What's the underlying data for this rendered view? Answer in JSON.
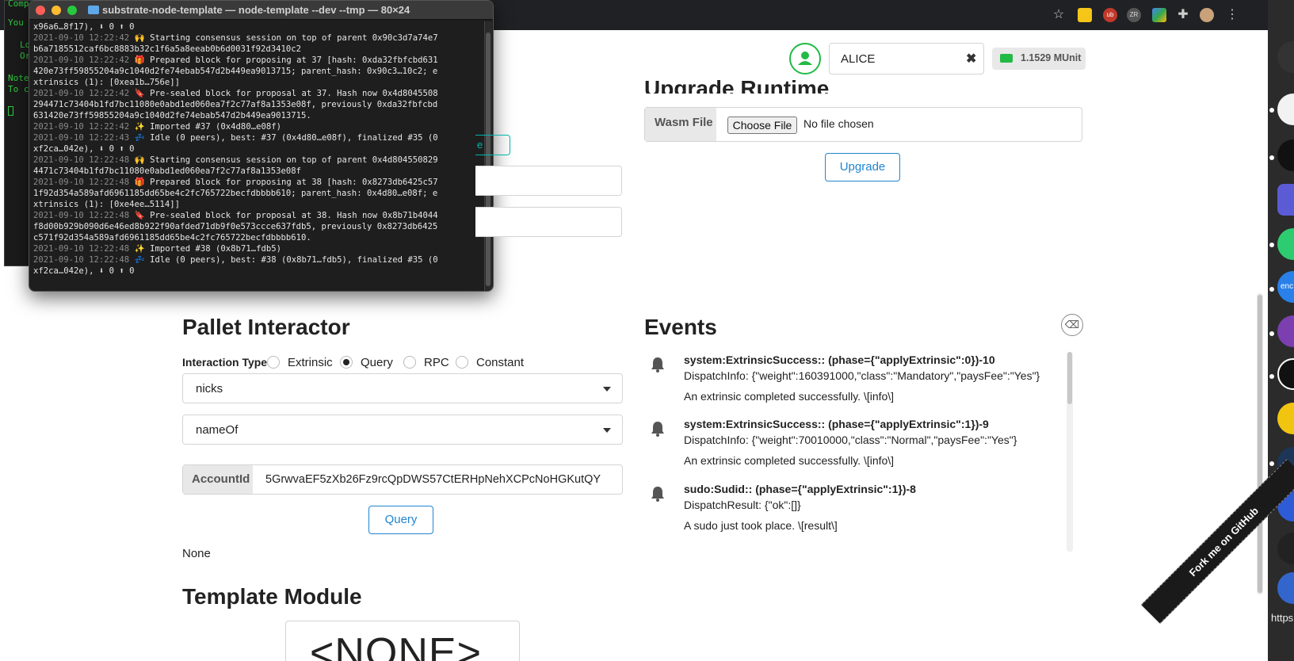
{
  "terminal": {
    "title": "substrate-node-template — node-template --dev --tmp — 80×24",
    "background_fragments": [
      "Comp",
      "You c",
      "Lo",
      "Or",
      "Note",
      "To c"
    ],
    "lines": [
      {
        "ts": "",
        "text": "x96a6…8f17), ⬇ 0 ⬆ 0"
      },
      {
        "ts": "2021-09-10 12:22:42",
        "text": " 🙌 Starting consensus session on top of parent 0x90c3d7a74e7"
      },
      {
        "ts": "",
        "text": "b6a7185512caf6bc8883b32c1f6a5a8eeab0b6d0031f92d3410c2"
      },
      {
        "ts": "2021-09-10 12:22:42",
        "text": " 🎁 Prepared block for proposing at 37 [hash: 0xda32fbfcbd631"
      },
      {
        "ts": "",
        "text": "420e73ff59855204a9c1040d2fe74ebab547d2b449ea9013715; parent_hash: 0x90c3…10c2; e"
      },
      {
        "ts": "",
        "text": "xtrinsics (1): [0xea1b…756e]]"
      },
      {
        "ts": "2021-09-10 12:22:42",
        "text": " 🔖 Pre-sealed block for proposal at 37. Hash now 0x4d8045508"
      },
      {
        "ts": "",
        "text": "294471c73404b1fd7bc11080e0abd1ed060ea7f2c77af8a1353e08f, previously 0xda32fbfcbd"
      },
      {
        "ts": "",
        "text": "631420e73ff59855204a9c1040d2fe74ebab547d2b449ea9013715."
      },
      {
        "ts": "2021-09-10 12:22:42",
        "text": " ✨ Imported #37 (0x4d80…e08f)"
      },
      {
        "ts": "2021-09-10 12:22:43",
        "text": " 💤 Idle (0 peers), best: #37 (0x4d80…e08f), finalized #35 (0"
      },
      {
        "ts": "",
        "text": "xf2ca…042e), ⬇ 0 ⬆ 0"
      },
      {
        "ts": "2021-09-10 12:22:48",
        "text": " 🙌 Starting consensus session on top of parent 0x4d804550829"
      },
      {
        "ts": "",
        "text": "4471c73404b1fd7bc11080e0abd1ed060ea7f2c77af8a1353e08f"
      },
      {
        "ts": "2021-09-10 12:22:48",
        "text": " 🎁 Prepared block for proposing at 38 [hash: 0x8273db6425c57"
      },
      {
        "ts": "",
        "text": "1f92d354a589afd6961185dd65be4c2fc765722becfdbbbb610; parent_hash: 0x4d80…e08f; e"
      },
      {
        "ts": "",
        "text": "xtrinsics (1): [0xe4ee…5114]]"
      },
      {
        "ts": "2021-09-10 12:22:48",
        "text": " 🔖 Pre-sealed block for proposal at 38. Hash now 0x8b71b4044"
      },
      {
        "ts": "",
        "text": "f8d00b929b090d6e46ed8b922f90afded71db9f0e573ccce637fdb5, previously 0x8273db6425"
      },
      {
        "ts": "",
        "text": "c571f92d354a589afd6961185dd65be4c2fc765722becfdbbbb610."
      },
      {
        "ts": "2021-09-10 12:22:48",
        "text": " ✨ Imported #38 (0x8b71…fdb5)"
      },
      {
        "ts": "2021-09-10 12:22:48",
        "text": " 💤 Idle (0 peers), best: #38 (0x8b71…fdb5), finalized #35 (0"
      },
      {
        "ts": "",
        "text": "xf2ca…042e), ⬇ 0 ⬆ 0"
      }
    ]
  },
  "header": {
    "account": "ALICE",
    "clear_symbol": "✖",
    "balance": "1.1529 MUnit"
  },
  "upgrade": {
    "title": "Upgrade Runtime",
    "wasm_label": "Wasm File",
    "choose_label": "Choose File",
    "no_file": "No file chosen",
    "button": "Upgrade"
  },
  "ghost": {
    "button_fragment": "e"
  },
  "pallet": {
    "title": "Pallet Interactor",
    "interaction_label": "Interaction Type",
    "types": [
      "Extrinsic",
      "Query",
      "RPC",
      "Constant"
    ],
    "selected_type": "Query",
    "pallet_value": "nicks",
    "callable_value": "nameOf",
    "account_label": "AccountId",
    "account_value": "5GrwvaEF5zXb26Fz9rcQpDWS57CtERHpNehXCPcNoHGKutQY",
    "query_button": "Query",
    "result": "None"
  },
  "template": {
    "title": "Template Module",
    "value": "<NONE>"
  },
  "events": {
    "title": "Events",
    "items": [
      {
        "head": "system:ExtrinsicSuccess:: (phase={\"applyExtrinsic\":0})-10",
        "info": "DispatchInfo: {\"weight\":160391000,\"class\":\"Mandatory\",\"paysFee\":\"Yes\"}",
        "desc": "An extrinsic completed successfully. \\[info\\]"
      },
      {
        "head": "system:ExtrinsicSuccess:: (phase={\"applyExtrinsic\":1})-9",
        "info": "DispatchInfo: {\"weight\":70010000,\"class\":\"Normal\",\"paysFee\":\"Yes\"}",
        "desc": "An extrinsic completed successfully. \\[info\\]"
      },
      {
        "head": "sudo:Sudid:: (phase={\"applyExtrinsic\":1})-8",
        "info": "DispatchResult: {\"ok\":[]}",
        "desc": "A sudo just took place. \\[result\\]"
      }
    ]
  },
  "ribbon": "Fork me on GitHub",
  "browser": {
    "side_partial": [
      "enc",
      "https"
    ],
    "ext_labels": [
      "ub",
      "ZR"
    ]
  },
  "colors": {
    "accent_blue": "#2185d0",
    "green": "#21ba45",
    "teal": "#00b5ad",
    "terminal_bg": "#1e1e1e"
  }
}
